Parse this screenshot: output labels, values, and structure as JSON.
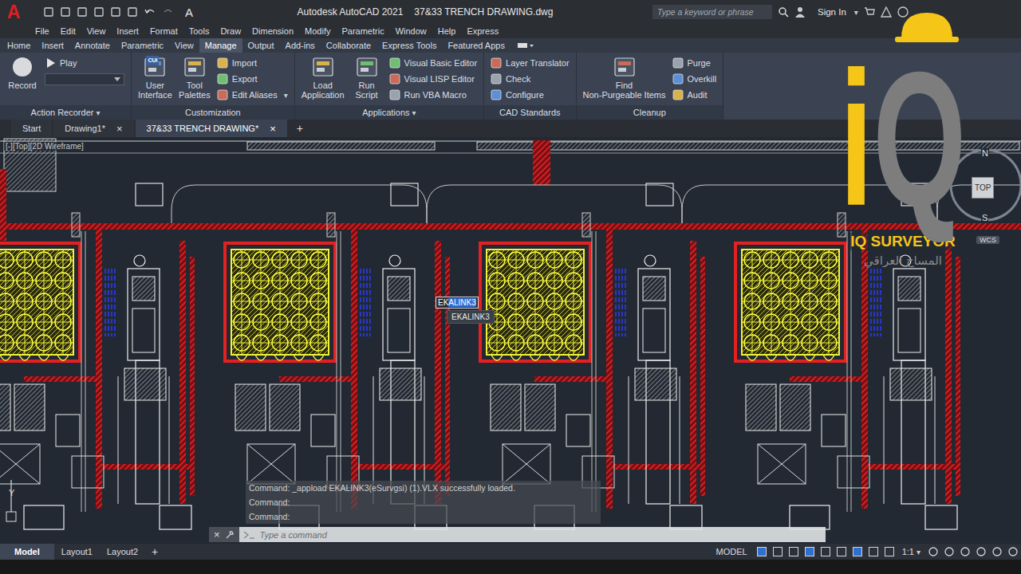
{
  "app_logo": "A",
  "quick_access": {
    "workspace_glyph": "A"
  },
  "window": {
    "title": "Autodesk AutoCAD 2021",
    "file": "37&33 TRENCH DRAWING.dwg"
  },
  "search": {
    "placeholder": "Type a keyword or phrase"
  },
  "account": {
    "label": "Sign In",
    "arrow": "▾"
  },
  "menu": [
    "File",
    "Edit",
    "View",
    "Insert",
    "Format",
    "Tools",
    "Draw",
    "Dimension",
    "Modify",
    "Parametric",
    "Window",
    "Help",
    "Express"
  ],
  "ribbon_tabs": [
    {
      "label": "Home",
      "selected": false
    },
    {
      "label": "Insert",
      "selected": false
    },
    {
      "label": "Annotate",
      "selected": false
    },
    {
      "label": "Parametric",
      "selected": false
    },
    {
      "label": "View",
      "selected": false
    },
    {
      "label": "Manage",
      "selected": true
    },
    {
      "label": "Output",
      "selected": false
    },
    {
      "label": "Add-ins",
      "selected": false
    },
    {
      "label": "Collaborate",
      "selected": false
    },
    {
      "label": "Express Tools",
      "selected": false
    },
    {
      "label": "Featured Apps",
      "selected": false
    }
  ],
  "ribbon_groups": [
    {
      "title": "Action Recorder",
      "arrow": "▾",
      "columns": [
        {
          "kind": "large",
          "lines": [
            "Record"
          ]
        },
        {
          "kind": "stack",
          "items": [
            {
              "kind": "button",
              "label": "Play"
            },
            {
              "kind": "combo"
            }
          ]
        }
      ]
    },
    {
      "title": "Customization",
      "arrow": "",
      "columns": [
        {
          "kind": "large",
          "lines": [
            "User",
            "Interface"
          ],
          "badge": "CUI"
        },
        {
          "kind": "large",
          "lines": [
            "Tool",
            "Palettes"
          ]
        },
        {
          "kind": "stack",
          "items": [
            {
              "kind": "button",
              "label": "Import"
            },
            {
              "kind": "button",
              "label": "Export"
            },
            {
              "kind": "button",
              "label": "Edit Aliases",
              "arrow": "▾"
            }
          ]
        }
      ]
    },
    {
      "title": "Applications",
      "arrow": "▾",
      "columns": [
        {
          "kind": "large",
          "lines": [
            "Load",
            "Application"
          ]
        },
        {
          "kind": "large",
          "lines": [
            "Run",
            "Script"
          ]
        },
        {
          "kind": "stack",
          "items": [
            {
              "kind": "button",
              "label": "Visual Basic Editor"
            },
            {
              "kind": "button",
              "label": "Visual LISP Editor"
            },
            {
              "kind": "button",
              "label": "Run VBA Macro"
            }
          ]
        }
      ]
    },
    {
      "title": "CAD Standards",
      "arrow": "",
      "columns": [
        {
          "kind": "stack",
          "items": [
            {
              "kind": "button",
              "label": "Layer Translator"
            },
            {
              "kind": "button",
              "label": "Check"
            },
            {
              "kind": "button",
              "label": "Configure"
            }
          ]
        }
      ]
    },
    {
      "title": "Cleanup",
      "arrow": "",
      "columns": [
        {
          "kind": "large",
          "lines": [
            "Find",
            "Non-Purgeable Items"
          ]
        },
        {
          "kind": "stack",
          "items": [
            {
              "kind": "button",
              "label": "Purge"
            },
            {
              "kind": "button",
              "label": "Overkill"
            },
            {
              "kind": "button",
              "label": "Audit"
            }
          ]
        }
      ]
    }
  ],
  "file_tabs": [
    {
      "label": "Start",
      "selected": false,
      "close": ""
    },
    {
      "label": "Drawing1*",
      "selected": false,
      "close": "×"
    },
    {
      "label": "37&33 TRENCH DRAWING*",
      "selected": true,
      "close": "×"
    }
  ],
  "new_tab": "+",
  "viewport_label": "[-][Top][2D Wireframe]",
  "viewcube": {
    "north": "N",
    "face": "TOP",
    "south": "S",
    "ucs": "WCS"
  },
  "ucs_axis": "Y",
  "autocomplete": {
    "typed": "EK",
    "completion": "ALINK3",
    "suggestions": [
      "EKALINK3"
    ]
  },
  "command_history": [
    "Command: _appload EKALINK3(eSurvgsi) (1).VLX successfully loaded.",
    "Command:",
    "Command:"
  ],
  "command_line": {
    "close": "×",
    "placeholder": "Type a command"
  },
  "layout_tabs": [
    {
      "label": "Model",
      "selected": true
    },
    {
      "label": "Layout1",
      "selected": false
    },
    {
      "label": "Layout2",
      "selected": false
    }
  ],
  "new_layout": "+",
  "status_bar": {
    "mode": "MODEL",
    "scale": "1:1",
    "arrow": "▾"
  },
  "watermark": {
    "mark_i": "i",
    "mark_q": "Q",
    "name": "IQ SURVEYOR",
    "subtitle": "المساح العراقي"
  }
}
